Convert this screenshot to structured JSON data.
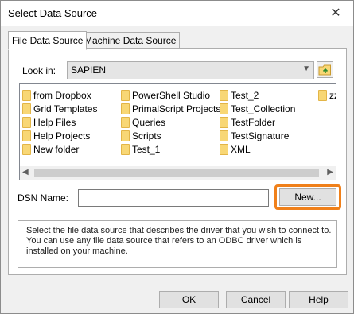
{
  "window": {
    "title": "Select Data Source",
    "close_glyph": "✕"
  },
  "tabs": [
    {
      "label": "File Data Source",
      "active": true
    },
    {
      "label": "Machine Data Source",
      "active": false
    }
  ],
  "look_in": {
    "label": "Look in:",
    "value": "SAPIEN"
  },
  "files": [
    "from Dropbox",
    "Grid Templates",
    "Help Files",
    "Help Projects",
    "New folder",
    "PowerShell Studio",
    "PrimalScript Projects",
    "Queries",
    "Scripts",
    "Test_1",
    "Test_2",
    "Test_Collection",
    "TestFolder",
    "TestSignature",
    "XML",
    "zz"
  ],
  "dsn": {
    "label": "DSN Name:",
    "value": "",
    "new_button": "New..."
  },
  "description": "Select the file data source that describes the driver that you wish to connect to. You can use any file data source that refers to an ODBC driver which is installed on your machine.",
  "buttons": {
    "ok": "OK",
    "cancel": "Cancel",
    "help": "Help"
  },
  "colors": {
    "highlight": "#f0801a",
    "folder": "#f8d775"
  }
}
